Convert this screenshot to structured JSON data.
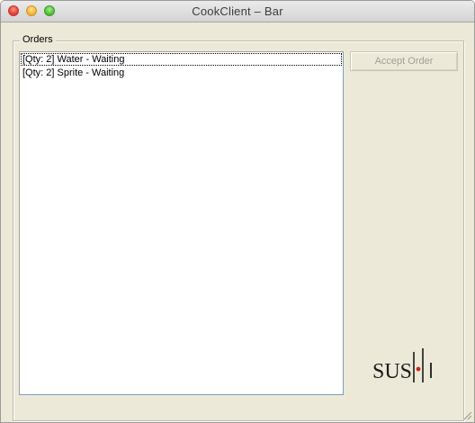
{
  "window": {
    "title": "CookClient – Bar"
  },
  "orders": {
    "group_label": "Orders",
    "items": [
      {
        "text": "[Qty: 2] Water - Waiting"
      },
      {
        "text": "[Qty: 2] Sprite - Waiting"
      }
    ]
  },
  "actions": {
    "accept_label": "Accept Order"
  },
  "logo": {
    "text": "SUSHI",
    "accent_color": "#d42020"
  },
  "colors": {
    "panel": "#ece9d8",
    "close": "#e0443e",
    "minimize": "#f5b73b",
    "maximize": "#57c038"
  },
  "icons": [
    "close-icon",
    "minimize-icon",
    "maximize-icon",
    "resize-grip-icon"
  ]
}
